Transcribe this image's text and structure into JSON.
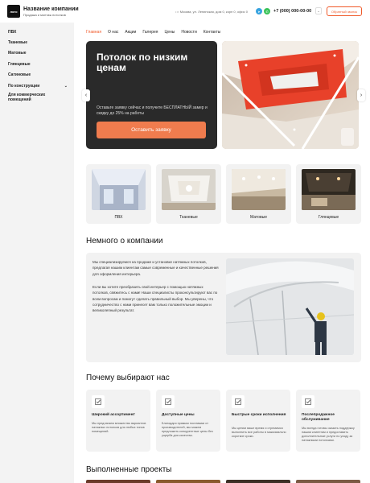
{
  "header": {
    "logo_text": "логo",
    "company_name": "Название компании",
    "company_sub": "Продажа и монтаж потолков",
    "address": "г. Москва, ул. Ленинская, дом 0, корп 0, офис 0",
    "phone": "+7 (000) 000-00-00",
    "callback": "Обратный звонок",
    "messenger_colors": {
      "telegram": "#36a3e0",
      "whatsapp": "#3ac35a"
    }
  },
  "sidebar": {
    "items": [
      {
        "label": "ПВХ"
      },
      {
        "label": "Тканевые"
      },
      {
        "label": "Матовые"
      },
      {
        "label": "Глянцевые"
      },
      {
        "label": "Сатиновые"
      },
      {
        "label": "По конструкции"
      },
      {
        "label": "Для коммерческих помещений"
      }
    ]
  },
  "nav": [
    "Главная",
    "О нас",
    "Акции",
    "Галерея",
    "Цены",
    "Новости",
    "Контакты"
  ],
  "hero": {
    "title": "Потолок по низким ценам",
    "text": "Оставьте заявку сейчас и получите  БЕСПЛАТНЫЙ замер и скидку до 25% на работы",
    "button": "Оставить заявку"
  },
  "categories": [
    {
      "label": "ПВХ"
    },
    {
      "label": "Тканевые"
    },
    {
      "label": "Матовые"
    },
    {
      "label": "Глянцевые"
    }
  ],
  "about": {
    "title": "Немного о компании",
    "p1": "Мы специализируемся на продаже и установке натяжных потолков, предлагая нашим клиентам самые современные и качественные решения для оформления интерьера.",
    "p2": "Если вы хотите преобразить свой интерьер с помощью натяжных потолков, свяжитесь с нами! Наши специалисты проконсультируют вас по всем вопросам и помогут сделать правильный выбор. Мы уверены, что сотрудничество с нами принесет вам только положительные эмоции и великолепный результат."
  },
  "why": {
    "title": "Почему выбирают нас",
    "cards": [
      {
        "title": "Широкий ассортимент",
        "desc": "Мы предлагаем множество вариантов натяжных потолков для любых типов помещений."
      },
      {
        "title": "Доступные цены",
        "desc": "Благодаря прямым поставкам от производителей, мы можем предложить конкурентные цены без ущерба для качества."
      },
      {
        "title": "Быстрые сроки исполнения",
        "desc": "Мы ценим ваше время и стремимся выполнить все работы в максимально короткие сроки."
      },
      {
        "title": "Послепродажное обслуживание",
        "desc": "Мы всегда готовы оказать поддержку нашим клиентам и предоставить дополнительные услуги по уходу за натяжными потолками."
      }
    ]
  },
  "projects": {
    "title": "Выполненные проекты"
  },
  "accent": "#f05a2a"
}
